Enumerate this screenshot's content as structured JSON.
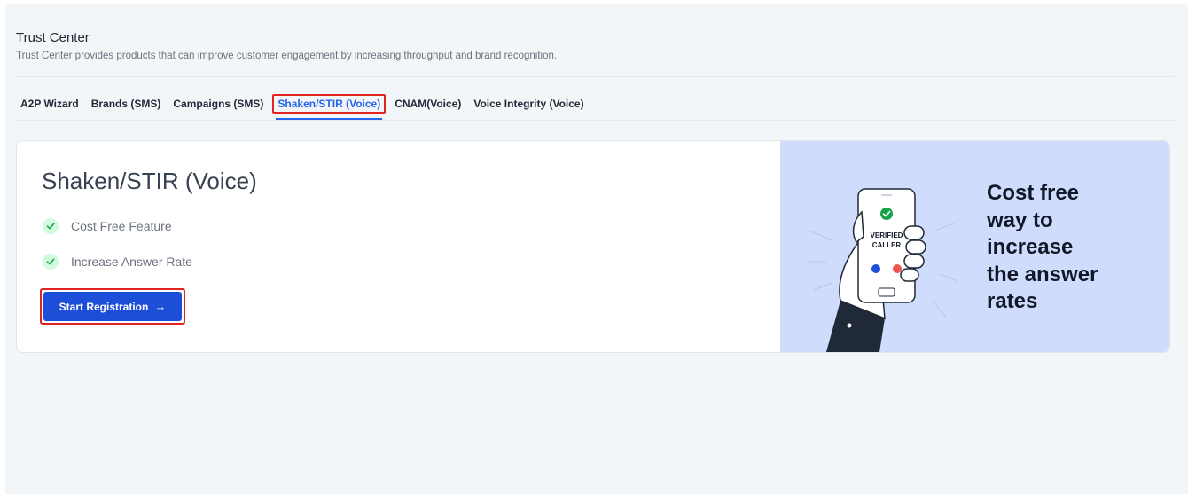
{
  "header": {
    "title": "Trust Center",
    "subtitle": "Trust Center provides products that can improve customer engagement by increasing throughput and brand recognition."
  },
  "tabs": [
    {
      "label": "A2P Wizard",
      "active": false
    },
    {
      "label": "Brands (SMS)",
      "active": false
    },
    {
      "label": "Campaigns (SMS)",
      "active": false
    },
    {
      "label": "Shaken/STIR (Voice)",
      "active": true
    },
    {
      "label": "CNAM(Voice)",
      "active": false
    },
    {
      "label": "Voice Integrity (Voice)",
      "active": false
    }
  ],
  "card": {
    "title": "Shaken/STIR (Voice)",
    "features": [
      "Cost Free Feature",
      "Increase Answer Rate"
    ],
    "button_label": "Start Registration",
    "button_icon": "arrow-right-icon",
    "promo_lines": [
      "Cost free",
      "way to",
      "increase",
      "the answer",
      "rates"
    ],
    "illustration": {
      "badge_line1": "VERIFIED",
      "badge_line2": "CALLER",
      "icon": "hand-holding-phone-icon"
    }
  },
  "colors": {
    "accent": "#1d4ed8",
    "highlight_border": "#e02424",
    "promo_background": "#cfdcfb",
    "check_background": "#d1fadf",
    "check_mark": "#16a34a"
  }
}
